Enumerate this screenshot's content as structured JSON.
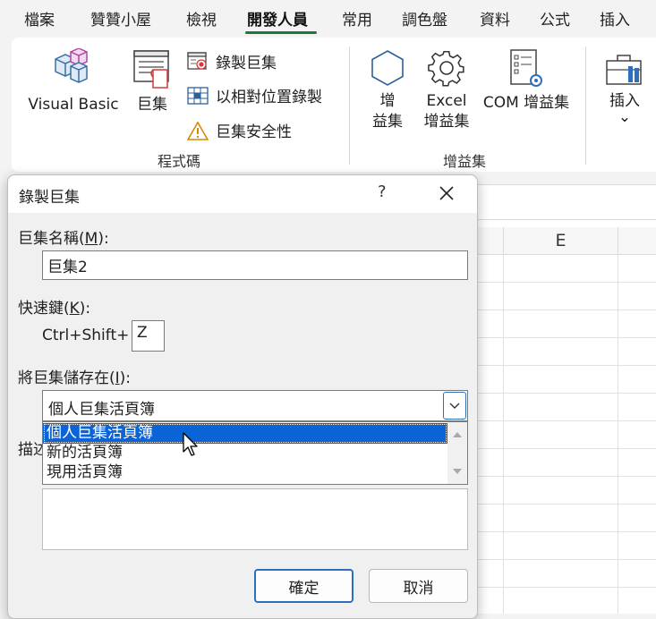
{
  "tabs": [
    "檔案",
    "贊贊小屋",
    "檢視",
    "開發人員",
    "常用",
    "調色盤",
    "資料",
    "公式",
    "插入"
  ],
  "active_tab": "開發人員",
  "ribbon": {
    "visual_basic": "Visual Basic",
    "macros": "巨集",
    "record_macro": "錄製巨集",
    "relative_ref": "以相對位置錄製",
    "macro_security": "巨集安全性",
    "group_code": "程式碼",
    "addins_line1": "增",
    "addins_line2": "益集",
    "excel_addins_line1": "Excel",
    "excel_addins_line2": "增益集",
    "com_addins": "COM 增益集",
    "group_addins": "增益集",
    "insert": "插入",
    "insert_chevron": "⌄"
  },
  "sheet": {
    "column": "E"
  },
  "dialog": {
    "title": "錄製巨集",
    "help": "?",
    "macro_name_label": "巨集名稱(",
    "macro_name_key": "M",
    "macro_name_suffix": "):",
    "macro_name_value": "巨集2",
    "shortcut_label": "快速鍵(",
    "shortcut_key": "K",
    "shortcut_suffix": "):",
    "shortcut_prefix": "Ctrl+Shift+",
    "shortcut_value": "Z",
    "store_label": "將巨集儲存在(",
    "store_key": "I",
    "store_suffix": "):",
    "store_selected": "個人巨集活頁簿",
    "store_options": [
      "個人巨集活頁簿",
      "新的活頁簿",
      "現用活頁簿"
    ],
    "description_label": "描述",
    "ok": "確定",
    "cancel": "取消"
  },
  "colors": {
    "accent": "#1b7a3a",
    "selection": "#0a64d8",
    "focus_border": "#2c6fbf"
  }
}
